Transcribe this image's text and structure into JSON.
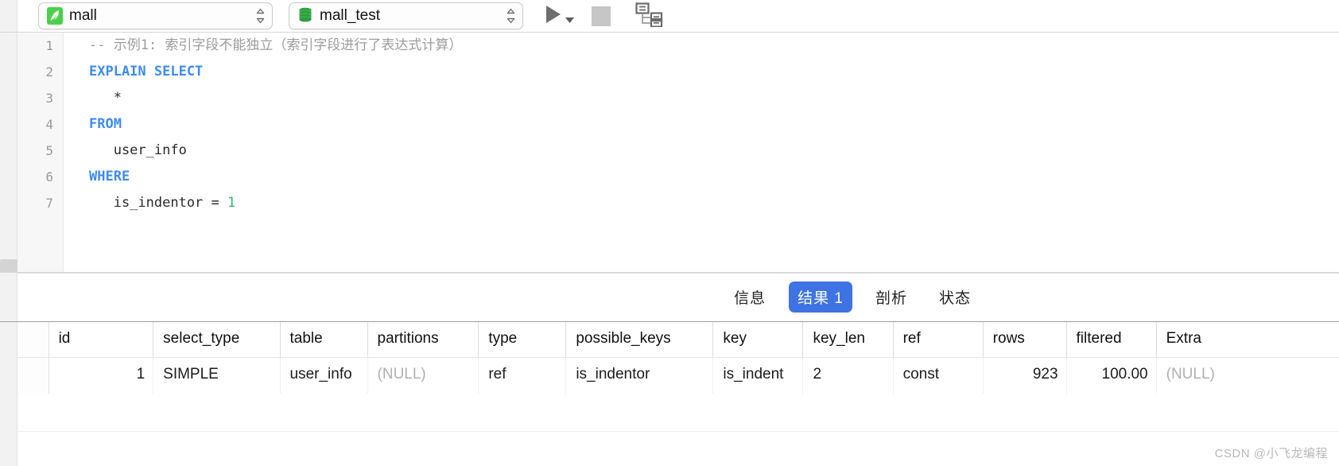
{
  "toolbar": {
    "connection": {
      "label": "mall",
      "icon": "dolphin-mysql-icon"
    },
    "database": {
      "label": "mall_test",
      "icon": "database-stack-icon"
    },
    "run_button": {
      "name": "run-query-button",
      "icon": "play-triangle-icon"
    },
    "run_dropdown": {
      "name": "run-options-dropdown",
      "icon": "caret-down-icon"
    },
    "stop_button": {
      "name": "stop-query-button",
      "icon": "stop-square-icon"
    },
    "explain_button": {
      "name": "explain-plan-button",
      "icon": "query-plan-tree-icon"
    }
  },
  "editor": {
    "lines": [
      {
        "n": "1",
        "segments": [
          {
            "t": "comment",
            "v": "-- 示例1: 索引字段不能独立（索引字段进行了表达式计算）"
          }
        ]
      },
      {
        "n": "2",
        "segments": [
          {
            "t": "kw",
            "v": "EXPLAIN SELECT"
          }
        ]
      },
      {
        "n": "3",
        "segments": [
          {
            "t": "plain",
            "v": "   *"
          }
        ]
      },
      {
        "n": "4",
        "segments": [
          {
            "t": "kw",
            "v": "FROM"
          }
        ]
      },
      {
        "n": "5",
        "segments": [
          {
            "t": "plain",
            "v": "   user_info"
          }
        ]
      },
      {
        "n": "6",
        "segments": [
          {
            "t": "kw",
            "v": "WHERE"
          }
        ]
      },
      {
        "n": "7",
        "segments": [
          {
            "t": "plain",
            "v": "   is_indentor = "
          },
          {
            "t": "num",
            "v": "1"
          }
        ]
      }
    ]
  },
  "tabs": [
    {
      "label": "信息",
      "active": false,
      "name": "tab-info"
    },
    {
      "label": "结果 1",
      "active": true,
      "name": "tab-result-1"
    },
    {
      "label": "剖析",
      "active": false,
      "name": "tab-profile"
    },
    {
      "label": "状态",
      "active": false,
      "name": "tab-status"
    }
  ],
  "result_grid": {
    "columns": [
      "id",
      "select_type",
      "table",
      "partitions",
      "type",
      "possible_keys",
      "key",
      "key_len",
      "ref",
      "rows",
      "filtered",
      "Extra"
    ],
    "rows": [
      {
        "id": "1",
        "select_type": "SIMPLE",
        "table": "user_info",
        "partitions": "(NULL)",
        "type": "ref",
        "possible_keys": "is_indentor",
        "key": "is_indent",
        "key_len": "2",
        "ref": "const",
        "rows": "923",
        "filtered": "100.00",
        "Extra": "(NULL)"
      }
    ]
  },
  "watermark": "CSDN @小飞龙编程",
  "colors": {
    "accent": "#3f73e3",
    "keyword": "#3d8bf2",
    "number": "#3cb371",
    "comment": "#9c9c9c",
    "null": "#b0b0b0"
  }
}
